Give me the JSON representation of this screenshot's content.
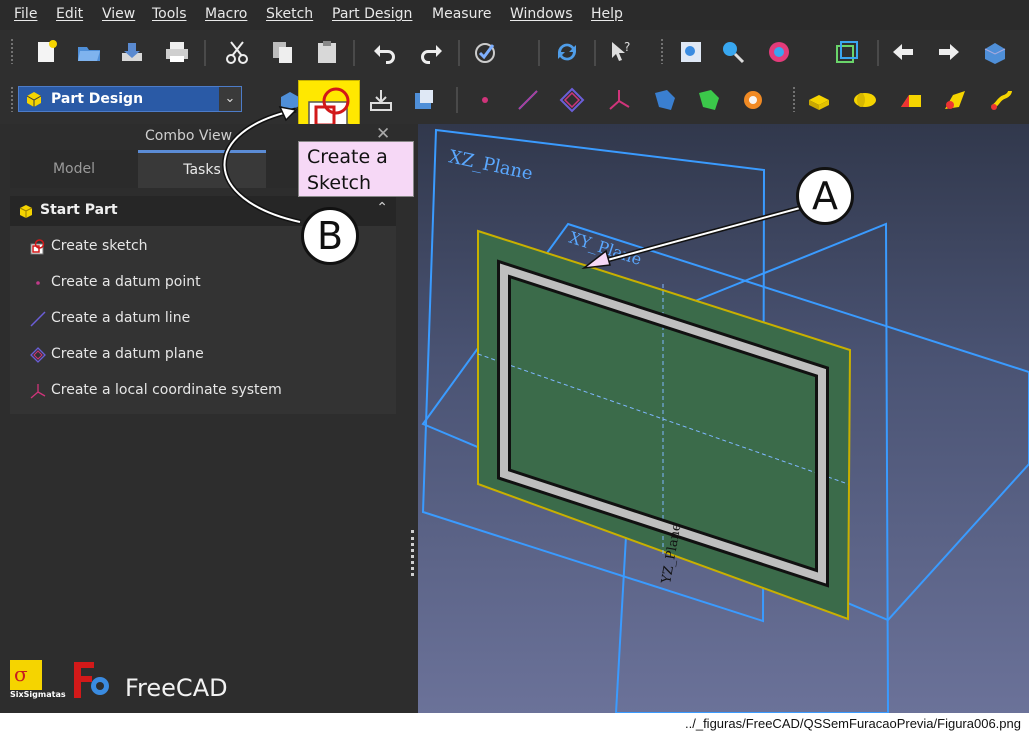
{
  "menu": {
    "items": [
      {
        "label": "File"
      },
      {
        "label": "Edit"
      },
      {
        "label": "View"
      },
      {
        "label": "Tools"
      },
      {
        "label": "Macro"
      },
      {
        "label": "Sketch"
      },
      {
        "label": "Part Design"
      },
      {
        "label": "Measure"
      },
      {
        "label": "Windows"
      },
      {
        "label": "Help"
      }
    ]
  },
  "workbench": {
    "selected": "Part Design",
    "icon": "part-design-icon"
  },
  "combo_view": {
    "title": "Combo View",
    "tabs": [
      {
        "label": "Model"
      },
      {
        "label": "Tasks"
      }
    ],
    "active_tab": "Tasks",
    "task_panel": {
      "header": "Start Part",
      "items": [
        {
          "label": "Create sketch",
          "icon": "sketch-icon"
        },
        {
          "label": "Create a datum point",
          "icon": "datum-point-icon"
        },
        {
          "label": "Create a datum line",
          "icon": "datum-line-icon"
        },
        {
          "label": "Create a datum plane",
          "icon": "datum-plane-icon"
        },
        {
          "label": "Create a local coordinate system",
          "icon": "local-cs-icon"
        }
      ]
    }
  },
  "branding": {
    "app_name": "FreeCAD",
    "logo_text": "SixSigmatas"
  },
  "tooltip": {
    "line1": "Create a",
    "line2": "Sketch"
  },
  "callouts": {
    "a": "A",
    "b": "B"
  },
  "viewport": {
    "plane_labels": [
      "XZ_Plane",
      "XY_Plane",
      "YZ_Plane"
    ]
  },
  "caption": "../_figuras/FreeCAD/QSSemFuracaoPrevia/Figura006.png",
  "colors": {
    "accent": "#2a5aa6",
    "tab_active": "#5b8cd6",
    "highlight": "#ffe800",
    "plane_blue": "#3a9bff",
    "sketch_green": "#3b6b4a"
  }
}
